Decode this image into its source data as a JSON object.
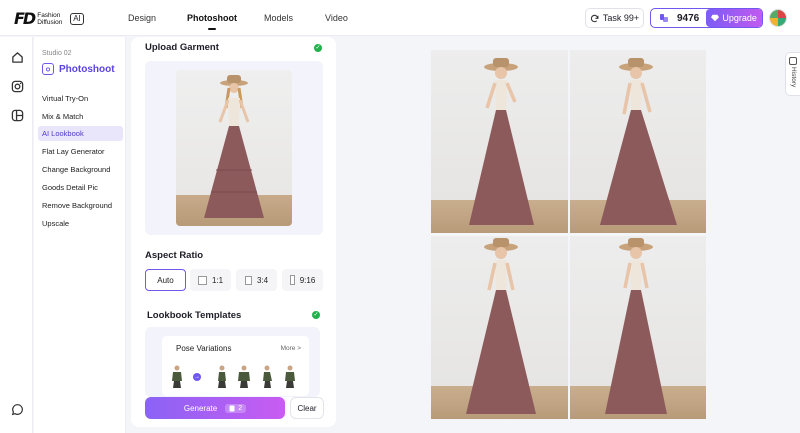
{
  "app": {
    "logo_mark": "FD",
    "logo_text": "Fashion Diffusion",
    "logo_ai": "AI"
  },
  "nav": {
    "items": [
      {
        "label": "Design",
        "active": false
      },
      {
        "label": "Photoshoot",
        "active": true
      },
      {
        "label": "Models",
        "active": false
      },
      {
        "label": "Video",
        "active": false
      }
    ]
  },
  "header": {
    "task_label": "Task 99+",
    "credits": "9476",
    "upgrade_label": "Upgrade"
  },
  "rail": {
    "icons": [
      "home-icon",
      "instagram-icon",
      "layout-icon",
      "chat-icon"
    ]
  },
  "menu": {
    "studio_label": "Studio 02",
    "studio_title": "Photoshoot",
    "items": [
      {
        "label": "Virtual Try-On",
        "active": false
      },
      {
        "label": "Mix & Match",
        "active": false
      },
      {
        "label": "AI Lookbook",
        "active": true
      },
      {
        "label": "Flat Lay Generator",
        "active": false
      },
      {
        "label": "Change Background",
        "active": false
      },
      {
        "label": "Goods Detail Pic",
        "active": false
      },
      {
        "label": "Remove Background",
        "active": false
      },
      {
        "label": "Upscale",
        "active": false
      }
    ]
  },
  "panel": {
    "upload_title": "Upload Garment",
    "aspect_title": "Aspect Ratio",
    "aspect_options": [
      {
        "label": "Auto",
        "active": true
      },
      {
        "label": "1:1",
        "active": false
      },
      {
        "label": "3:4",
        "active": false
      },
      {
        "label": "9:16",
        "active": false
      }
    ],
    "templates_title": "Lookbook Templates",
    "pose_title": "Pose Variations",
    "pose_more": "More >",
    "generate_label": "Generate",
    "generate_cost": "2",
    "clear_label": "Clear"
  },
  "history": {
    "label": "History"
  },
  "colors": {
    "accent": "#6f57f0",
    "active_menu_bg": "#e9e6fb",
    "success": "#22b14c",
    "skirt": "#8d5a5c",
    "top": "#efe6db",
    "hat": "#c7a27a"
  }
}
